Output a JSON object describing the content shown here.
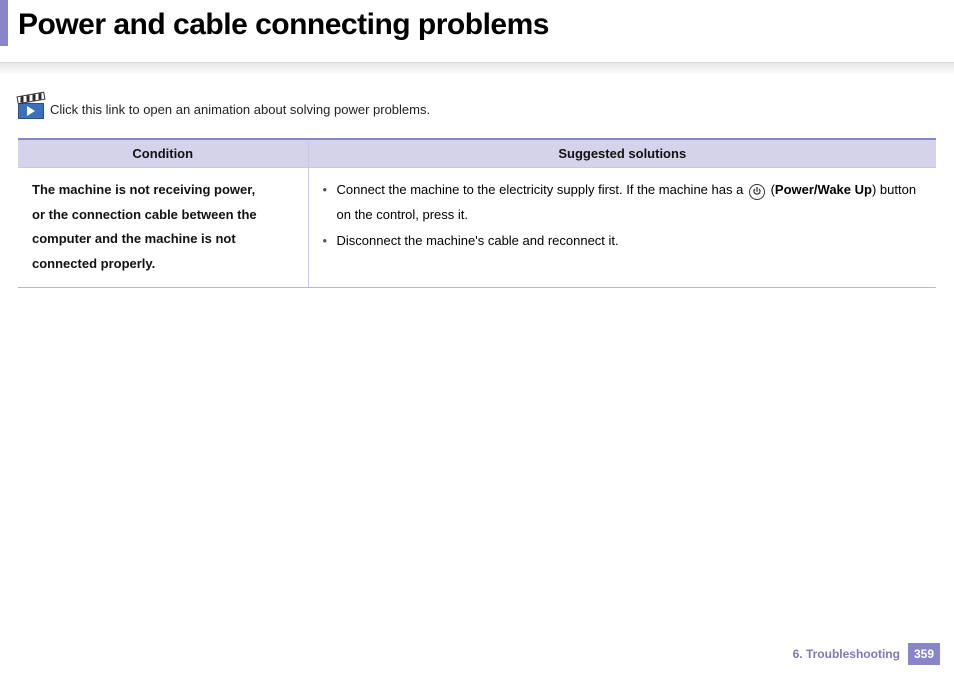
{
  "header": {
    "title": "Power and cable connecting problems"
  },
  "intro": {
    "text": "Click this link to open an animation about solving power problems."
  },
  "table": {
    "headers": {
      "condition": "Condition",
      "solutions": "Suggested solutions"
    },
    "row": {
      "condition_line1": "The machine is not receiving power,",
      "condition_line2": "or the connection cable between the computer and the machine is not connected properly.",
      "sol1_before": "Connect the machine to the electricity supply first. If the machine has a ",
      "sol1_paren_open": "(",
      "sol1_bold": "Power/Wake Up",
      "sol1_paren_close": ")",
      "sol1_after": " button on the control, press it.",
      "sol2": "Disconnect the machine's cable and reconnect it."
    }
  },
  "footer": {
    "chapter": "6.  Troubleshooting",
    "page": "359"
  }
}
